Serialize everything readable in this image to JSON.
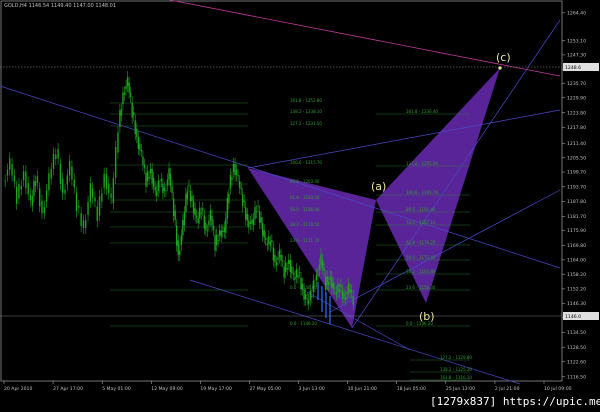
{
  "title": "GOLD,H4  1146.54 1149.40 1147.00 1148.01",
  "watermark": "[1279x837] https://upic.me/",
  "current_price": "1248.6",
  "last_price": "1146.0",
  "chart_data": {
    "type": "candlestick",
    "symbol": "GOLD",
    "timeframe": "H4",
    "ylim": [
      1116,
      1268
    ],
    "y_ticks": [
      "1264.40",
      "1253.10",
      "1247.30",
      "1241.50",
      "1235.70",
      "1229.90",
      "1223.80",
      "1217.80",
      "1211.40",
      "1205.50",
      "1199.70",
      "1193.70",
      "1187.80",
      "1181.70",
      "1175.90",
      "1169.80",
      "1164.00",
      "1158.20",
      "1152.20",
      "1146.30",
      "1140.50",
      "1134.50",
      "1128.50",
      "1122.60",
      "1116.50"
    ],
    "x_ticks": [
      "20 Apr 2010",
      "27 Apr 17:00",
      "5 May 01:00",
      "12 May 09:00",
      "19 May 17:00",
      "27 May 05:00",
      "3 Jun 13:00",
      "10 Jun 21:00",
      "18 Jun 05:00",
      "25 Jun 13:00",
      "2 Jul 21:00",
      "10 Jul 09:00"
    ],
    "price_path": [
      [
        0,
        1196
      ],
      [
        3,
        1203
      ],
      [
        6,
        1189
      ],
      [
        9,
        1200
      ],
      [
        12,
        1186
      ],
      [
        14,
        1198
      ],
      [
        17,
        1183
      ],
      [
        20,
        1197
      ],
      [
        23,
        1209
      ],
      [
        26,
        1191
      ],
      [
        29,
        1202
      ],
      [
        32,
        1186
      ],
      [
        35,
        1177
      ],
      [
        38,
        1193
      ],
      [
        41,
        1182
      ],
      [
        44,
        1199
      ],
      [
        47,
        1187
      ],
      [
        50,
        1218
      ],
      [
        52,
        1232
      ],
      [
        54,
        1236
      ],
      [
        56,
        1224
      ],
      [
        58,
        1214
      ],
      [
        60,
        1206
      ],
      [
        62,
        1196
      ],
      [
        64,
        1201
      ],
      [
        66,
        1190
      ],
      [
        68,
        1196
      ],
      [
        70,
        1192
      ],
      [
        72,
        1199
      ],
      [
        74,
        1184
      ],
      [
        76,
        1166
      ],
      [
        78,
        1178
      ],
      [
        80,
        1194
      ],
      [
        82,
        1188
      ],
      [
        84,
        1179
      ],
      [
        86,
        1185
      ],
      [
        88,
        1176
      ],
      [
        90,
        1182
      ],
      [
        92,
        1170
      ],
      [
        94,
        1176
      ],
      [
        96,
        1175
      ],
      [
        98,
        1193
      ],
      [
        100,
        1203
      ],
      [
        102,
        1196
      ],
      [
        104,
        1188
      ],
      [
        106,
        1180
      ],
      [
        108,
        1178
      ],
      [
        110,
        1186
      ],
      [
        112,
        1179
      ],
      [
        114,
        1170
      ],
      [
        116,
        1172
      ],
      [
        118,
        1163
      ],
      [
        120,
        1166
      ],
      [
        122,
        1159
      ],
      [
        124,
        1164
      ],
      [
        126,
        1156
      ],
      [
        128,
        1159
      ],
      [
        130,
        1152
      ],
      [
        132,
        1146
      ],
      [
        134,
        1151
      ],
      [
        136,
        1158
      ],
      [
        138,
        1164
      ],
      [
        140,
        1154
      ],
      [
        142,
        1157
      ],
      [
        144,
        1150
      ],
      [
        146,
        1153
      ],
      [
        148,
        1149
      ],
      [
        150,
        1152
      ],
      [
        152,
        1148
      ]
    ],
    "harmonic_points": [
      "(a)",
      "(b)",
      "(c)"
    ],
    "fib_levels": [
      "161.8 - 1252.80",
      "138.2 - 1238.10",
      "127.2 - 1231.50",
      "100.0 - 1215.70",
      "80.0 - 1203.40",
      "61.8 - 1193.20",
      "50.0 - 1186.00",
      "38.2 - 1178.50",
      "23.6 - 1171.70",
      "0.0 - 1156.00",
      "0.0 - 1146.20",
      "161.8 - 1236.40",
      "127.2 - 1205.00",
      "100.0 - 1195.70",
      "88.6 - 1191.40",
      "78.6 - 1187.10",
      "61.8 - 1178.20",
      "50.0 - 1172.40",
      "38.2 - 1165.80",
      "23.6 - 1156.30",
      "0.0 - 1146.20",
      "127.2 - 1129.80",
      "138.2 - 1125.30",
      "161.8 - 1116.10"
    ]
  }
}
